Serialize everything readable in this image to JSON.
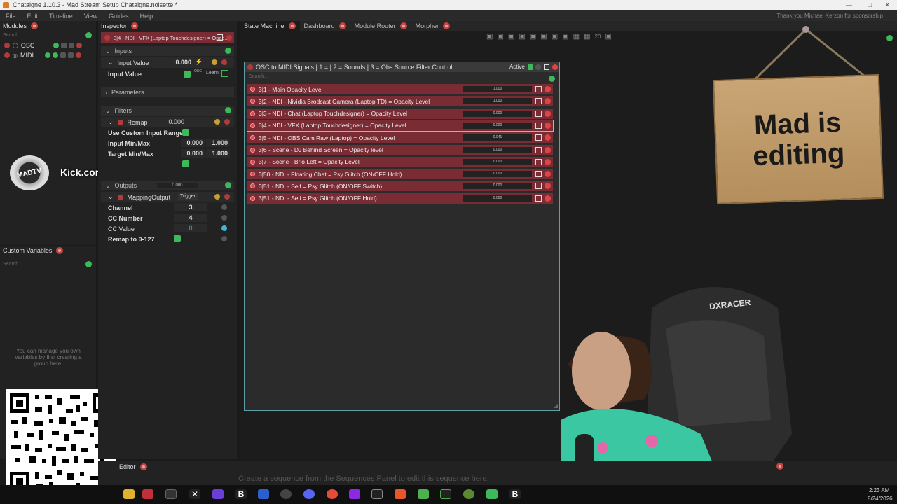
{
  "window": {
    "title": "Chataigne 1.10.3 - Mad Stream Setup Chataigne.noisette *"
  },
  "menu": [
    "File",
    "Edit",
    "Timeline",
    "View",
    "Guides",
    "Help"
  ],
  "menu_right": "Thank you Michael Kerzon for sponsorship",
  "modules_panel": {
    "title": "Modules",
    "search": "Search...",
    "modules": [
      {
        "name": "OSC"
      },
      {
        "name": "MIDI"
      }
    ]
  },
  "custom_vars": {
    "title": "Custom Variables",
    "search": "Search...",
    "empty_msg": "You can manage you own variables by first creating a group here."
  },
  "inspector": {
    "title": "Inspector",
    "item": "3|4 - NDI - VFX (Laptop Touchdesigner) = Opac...",
    "inputs_label": "Inputs",
    "input_value_label": "Input Value",
    "input_value": "0.000",
    "input_value_row": "Input Value",
    "osc_label": "OSC",
    "learn_label": "Learn",
    "parameters_label": "Parameters",
    "filters_label": "Filters",
    "remap_label": "Remap",
    "remap_value": "0.000",
    "use_custom_label": "Use Custom Input Range",
    "in_minmax_label": "Input Min/Max",
    "in_min": "0.000",
    "in_max": "1.000",
    "tgt_minmax_label": "Target Min/Max",
    "tgt_min": "0.000",
    "tgt_max": "1.000",
    "outputs_label": "Outputs",
    "outputs_value": "0.000",
    "mapping_output_label": "MappingOutput",
    "trigger_label": "Trigger",
    "channel_label": "Channel",
    "channel_value": "3",
    "cc_number_label": "CC Number",
    "cc_number_value": "4",
    "cc_value_label": "CC Value",
    "cc_value": "0",
    "remap127_label": "Remap to 0-127"
  },
  "overlay": {
    "kick": "Kick.com/MadTV",
    "logo": "MADTV"
  },
  "tabs": [
    {
      "label": "State Machine"
    },
    {
      "label": "Dashboard"
    },
    {
      "label": "Module Router"
    },
    {
      "label": "Morpher"
    }
  ],
  "toolbar_zoom": "20",
  "mapping_window": {
    "title": "OSC to MIDI Signals | 1 =  | 2 = Sounds | 3 = Obs Source Filter Control",
    "active_label": "Active",
    "search": "Search...",
    "rows": [
      {
        "label": "3|1 - Main Opacity Level",
        "value": "1.000",
        "level": 1.0
      },
      {
        "label": "3|2 - NDI - Nividia Brodcast Camera (Laptop TD) = Opacity Level",
        "value": "1.000",
        "level": 1.0
      },
      {
        "label": "3|3 - NDI - Chat (Laptop Touchdesigner) = Opacity Level",
        "value": "0.000",
        "level": 0
      },
      {
        "label": "3|4 - NDI - VFX (Laptop Touchdesigner) = Opacity Level",
        "value": "0.000",
        "level": 0
      },
      {
        "label": "3|5 - NDI - OBS Cam Raw (Laptop) = Opacity Level",
        "value": "0.041",
        "level": 0.041
      },
      {
        "label": "3|6 - Scene - DJ Behind Screen = Opacity level",
        "value": "0.000",
        "level": 0
      },
      {
        "label": "3|7 - Scene - Brio Left = Opacity Level",
        "value": "0.000",
        "level": 0
      },
      {
        "label": "3|50 - NDI - Floating Chat = Psy Glitch (ON/OFF Hold)",
        "value": "0.000",
        "level": 0
      },
      {
        "label": "3|51 - NDI - Self = Psy Glitch (ON/OFF Switch)",
        "value": "0.000",
        "level": 0
      },
      {
        "label": "3|51 - NDI - Self = Psy Glitch (ON/OFF Hold)",
        "value": "0.000",
        "level": 0
      }
    ]
  },
  "sign": {
    "line1": "Mad is",
    "line2": "editing"
  },
  "chair_brand": "DXRACER",
  "bottom": {
    "editor_label": "Editor",
    "sequence_msg": "Create a sequence from the Sequences Panel to edit this sequence here."
  },
  "taskbar": {
    "time": "2:23 AM",
    "date": "8/24/2026"
  },
  "colors": {
    "accent_green": "#3db85b",
    "close_red": "#c54444",
    "row_red": "#7a2c34",
    "cyan": "#29b6e5"
  }
}
